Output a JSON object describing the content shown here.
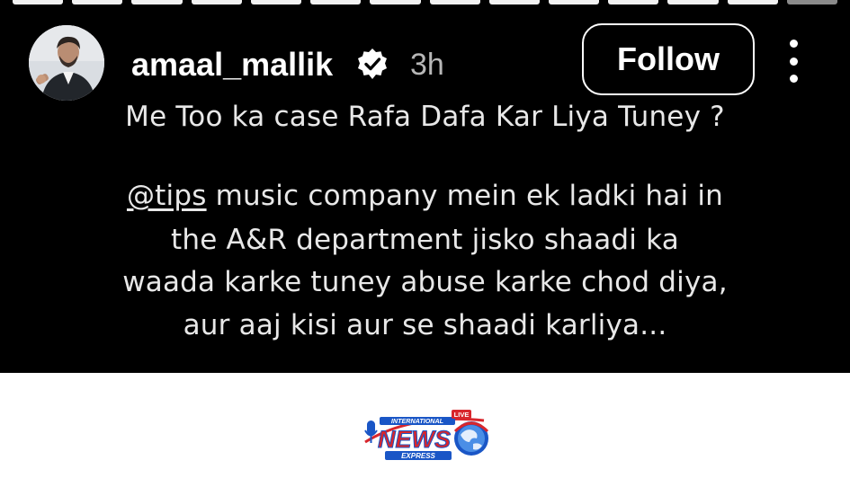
{
  "story": {
    "progress_segments": [
      "done",
      "done",
      "done",
      "done",
      "done",
      "done",
      "done",
      "done",
      "done",
      "done",
      "done",
      "done",
      "done",
      "pending"
    ],
    "user": {
      "username": "amaal_mallik",
      "verified_icon": "verified-badge-icon",
      "time": "3h"
    },
    "follow_label": "Follow",
    "more_icon": "more-vertical-icon",
    "caption": {
      "line1": "Me Too ka case Rafa Dafa Kar Liya Tuney ?",
      "mention": "@tips",
      "line2_rest": " music company mein ek ladki hai in",
      "line3": "the A&R department jisko shaadi ka",
      "line4": "waada karke tuney abuse karke chod diya,",
      "line5": "aur aaj kisi aur se shaadi karliya..."
    }
  },
  "watermark": {
    "brand_top": "INTERNATIONAL",
    "brand_main": "NEWS",
    "brand_bottom": "EXPRESS",
    "live": "LIVE"
  },
  "colors": {
    "story_bg": "#000000",
    "text": "#ffffff",
    "muted": "#b7b7b7",
    "logo_blue": "#1a56c6",
    "logo_red": "#d8262c"
  }
}
